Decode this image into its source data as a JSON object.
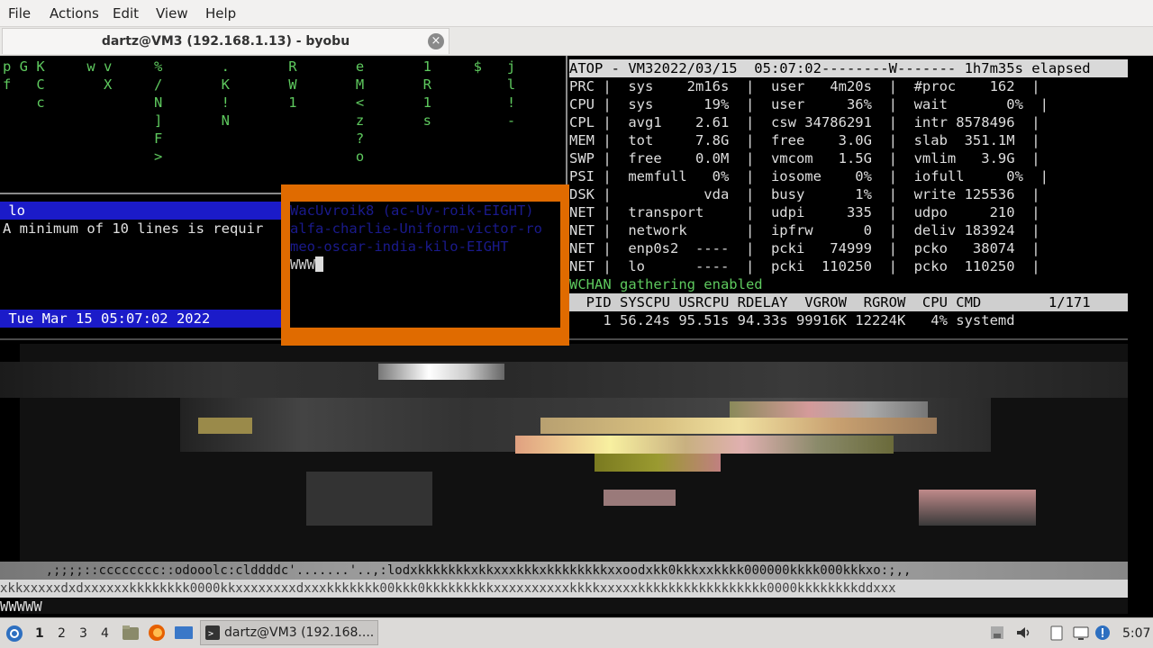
{
  "menu": [
    "File",
    "Actions",
    "Edit",
    "View",
    "Help"
  ],
  "tab": {
    "title": "dartz@VM3 (192.168.1.13) - byobu",
    "close": "×"
  },
  "left_pane": {
    "matrix_rows": [
      "p G K     w v     %       .       R       e       1     $   j",
      "f   C       X     /       K       W       M       R         l",
      "    c             N       !       1       <       1         !",
      "                  ]       N               z       s         -",
      "                  F                       ?",
      "                  >                       o"
    ],
    "status_bar": " lo",
    "message": "A minimum of 10 lines is requir",
    "clock_bar": " Tue Mar 15 05:07:02 2022"
  },
  "overlay": {
    "lines": [
      "WacUvroik8 (ac-Uv-roik-EIGHT)",
      "alfa-charlie-Uniform-victor-ro",
      "meo-oscar-india-kilo-EIGHT",
      "WWW"
    ]
  },
  "atop": {
    "header": "ATOP - VM32022/03/15  05:07:02--------W------- 1h7m35s elapsed",
    "rows": [
      "PRC |  sys    2m16s  |  user   4m20s  |  #proc    162  |",
      "CPU |  sys      19%  |  user     36%  |  wait       0%  |",
      "CPL |  avg1    2.61  |  csw 34786291  |  intr 8578496  |",
      "MEM |  tot     7.8G  |  free    3.0G  |  slab  351.1M  |",
      "SWP |  free    0.0M  |  vmcom   1.5G  |  vmlim   3.9G  |",
      "PSI |  memfull   0%  |  iosome    0%  |  iofull     0%  |",
      "DSK |           vda  |  busy      1%  |  write 125536  |",
      "NET |  transport     |  udpi     335  |  udpo     210  |",
      "NET |  network       |  ipfrw      0  |  deliv 183924  |",
      "NET |  enp0s2  ----  |  pcki   74999  |  pcko   38074  |",
      "NET |  lo      ----  |  pcki  110250  |  pcko  110250  |"
    ],
    "wchan": "WCHAN gathering enabled",
    "proc_header": "  PID SYSCPU USRCPU RDELAY  VGROW  RGROW  CPU CMD        1/171",
    "proc_row": "    1 56.24s 95.51s 94.33s 99916K 12224K   4% systemd"
  },
  "ascii_art": {
    "line1": "      ,;;;;::cccccccc::odooolc:clddddc'.......'..,:lodxkkkkkkkxkkxxxkkkxkkkkkkkkxxoodxkk0kkkxxkkkk000000kkkk000kkkxo:;,,",
    "line2": "xkkxxxxxdxdxxxxxxkkkkkkkk0000kkxxxxxxxxdxxxkkkkkkk00kkk0kkkkkkkkkxxxxxxxxxxkkkkxxxxxkkkkkkkkkkkkkkkkk0000kkkkkkkkddxxx",
    "bottom": "WWWWW"
  },
  "taskbar": {
    "workspaces": [
      "1",
      "2",
      "3",
      "4"
    ],
    "window_label": "dartz@VM3 (192.168....",
    "clock": "5:07"
  },
  "colors": {
    "accent_orange": "#e06b00",
    "status_blue": "#1b1bc9",
    "terminal_green": "#5ec95e"
  }
}
